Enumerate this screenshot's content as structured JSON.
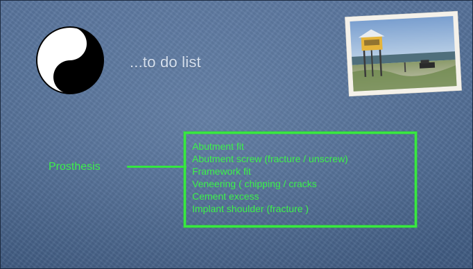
{
  "slide": {
    "title": "...to do list",
    "label": "Prosthesis",
    "items": [
      "Abutment fit",
      "Abutment screw (fracture / unscrew)",
      "Framework fit",
      "Veneering ( chipping / cracks",
      "Cement excess",
      "Implant shoulder (fracture )"
    ]
  },
  "colors": {
    "background": "#4c688f",
    "accent_green": "#3cf04a",
    "title_text": "#d6e0ee"
  },
  "icons": {
    "yin_yang": "yin-yang-icon",
    "photo": "beach-lifeguard-tower-photo"
  }
}
